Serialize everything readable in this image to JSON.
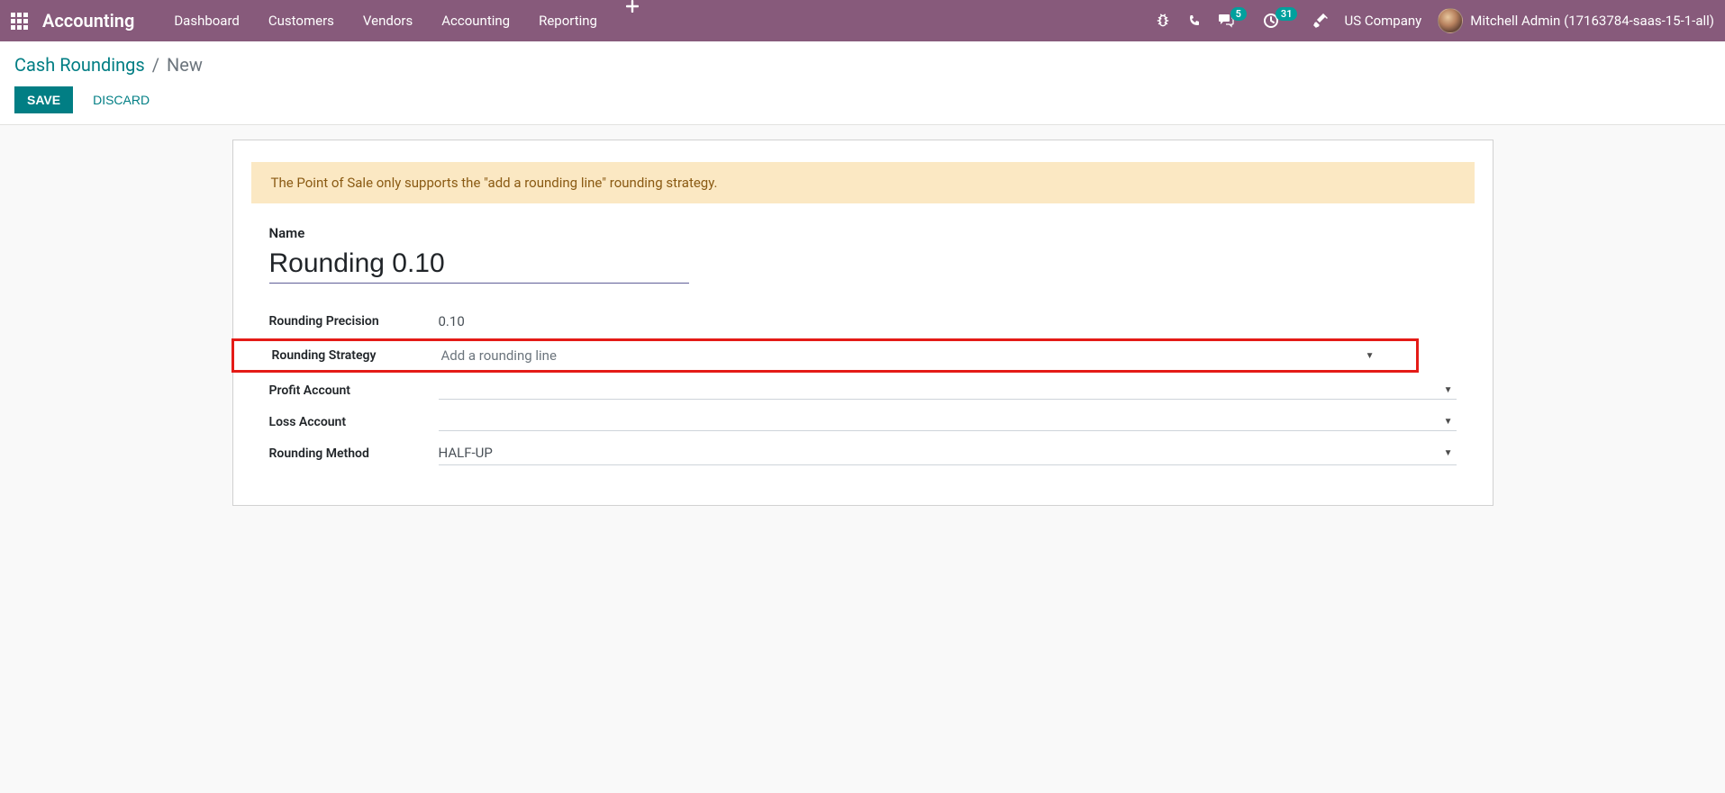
{
  "topnav": {
    "app_title": "Accounting",
    "links": [
      "Dashboard",
      "Customers",
      "Vendors",
      "Accounting",
      "Reporting"
    ],
    "messages_count": "5",
    "activities_count": "31",
    "company": "US Company",
    "user": "Mitchell Admin (17163784-saas-15-1-all)"
  },
  "breadcrumb": {
    "parent": "Cash Roundings",
    "current": "New"
  },
  "buttons": {
    "save": "Save",
    "discard": "Discard"
  },
  "alert": "The Point of Sale only supports the \"add a rounding line\" rounding strategy.",
  "form": {
    "name_label": "Name",
    "name_value": "Rounding 0.10",
    "precision_label": "Rounding Precision",
    "precision_value": "0.10",
    "strategy_label": "Rounding Strategy",
    "strategy_value": "Add a rounding line",
    "profit_label": "Profit Account",
    "profit_value": "",
    "loss_label": "Loss Account",
    "loss_value": "",
    "method_label": "Rounding Method",
    "method_value": "HALF-UP"
  }
}
